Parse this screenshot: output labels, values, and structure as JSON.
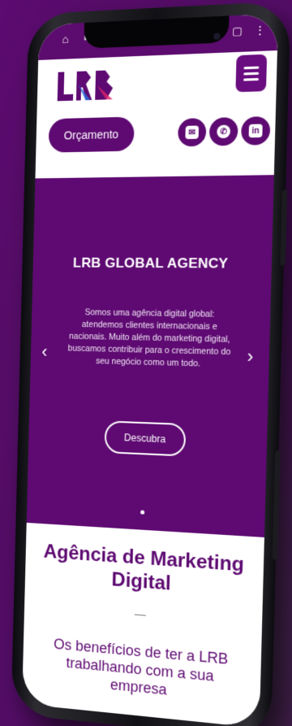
{
  "header": {
    "quote_button": "Orçamento",
    "social": [
      {
        "name": "email-icon",
        "glyph": "✉"
      },
      {
        "name": "whatsapp-icon",
        "glyph": "✆"
      },
      {
        "name": "linkedin-icon",
        "glyph": "in"
      }
    ]
  },
  "hero": {
    "title": "LRB GLOBAL AGENCY",
    "text": "Somos uma agência digital global: atendemos clientes internacionais e nacionais. Muito além do marketing digital, buscamos contribuir para o crescimento do seu negócio como um todo.",
    "cta": "Descubra",
    "prev_glyph": "‹",
    "next_glyph": "›"
  },
  "section": {
    "heading": "Agência de Marketing Digital",
    "subheading": "Os benefícios de ter a LRB trabalhando com a sua empresa"
  },
  "colors": {
    "brand": "#5e0a72",
    "background": "#5a0a6e"
  }
}
